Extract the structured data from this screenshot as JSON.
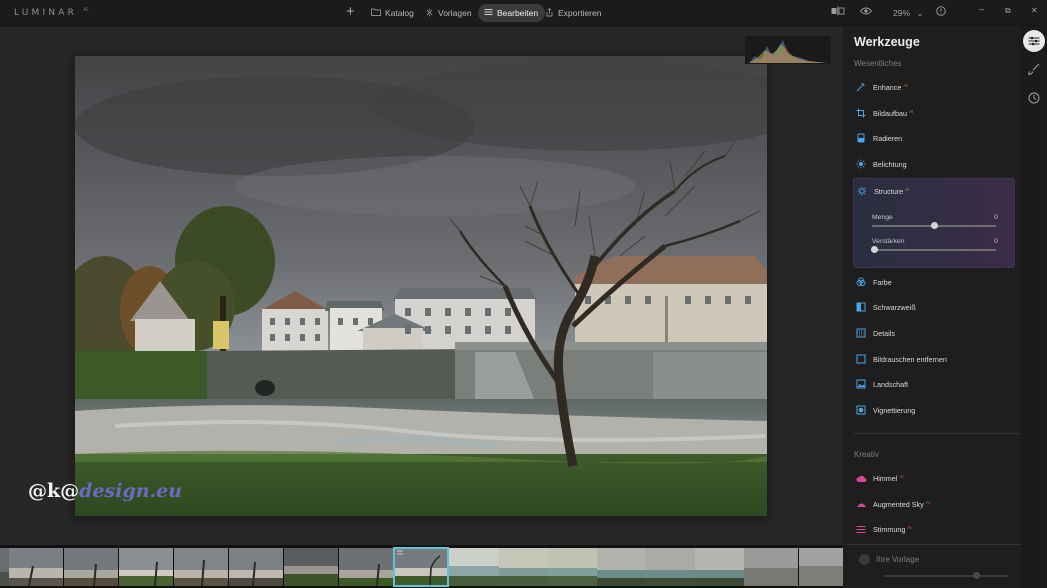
{
  "app": {
    "logo": "LUMINAR",
    "logo_sup": "AI"
  },
  "nav": {
    "add": "+",
    "items": [
      {
        "label": "Katalog",
        "icon": "folder-icon"
      },
      {
        "label": "Vorlagen",
        "icon": "sparkle-icon"
      },
      {
        "label": "Bearbeiten",
        "icon": "sliders-icon",
        "active": true
      },
      {
        "label": "Exportieren",
        "icon": "share-icon"
      }
    ]
  },
  "topright": {
    "zoom": "29%",
    "zoom_caret": "⌄",
    "minimize": "–",
    "restore": "⧉",
    "close": "✕"
  },
  "watermark": {
    "prefix": "@k@",
    "suffix": "design.eu"
  },
  "panel": {
    "title": "Werkzeuge",
    "essentials_label": "Wesentliches",
    "creative_label": "Kreativ",
    "ai_badge": "AI",
    "essentials": [
      {
        "label": "Enhance",
        "ai": true,
        "icon": "enhance-icon"
      },
      {
        "label": "Bildaufbau",
        "ai": true,
        "icon": "crop-icon"
      },
      {
        "label": "Radieren",
        "ai": false,
        "icon": "eraser-icon"
      },
      {
        "label": "Belichtung",
        "ai": false,
        "icon": "sun-icon"
      },
      {
        "label": "Structure",
        "ai": true,
        "icon": "structure-icon",
        "expanded": true
      },
      {
        "label": "Farbe",
        "ai": false,
        "icon": "color-icon"
      },
      {
        "label": "Schwarzweiß",
        "ai": false,
        "icon": "bw-icon"
      },
      {
        "label": "Details",
        "ai": false,
        "icon": "details-icon"
      },
      {
        "label": "Bildrauschen entfernen",
        "ai": false,
        "icon": "denoise-icon"
      },
      {
        "label": "Landschaft",
        "ai": false,
        "icon": "landscape-icon"
      },
      {
        "label": "Vignettierung",
        "ai": false,
        "icon": "vignette-icon"
      }
    ],
    "structure_sliders": [
      {
        "label": "Menge",
        "value": "0",
        "fraction": 0.5
      },
      {
        "label": "Verstärken",
        "value": "0",
        "fraction": 0.0
      }
    ],
    "creative": [
      {
        "label": "Himmel",
        "ai": true,
        "icon": "cloud-icon"
      },
      {
        "label": "Augmented Sky",
        "ai": true,
        "icon": "sky-icon"
      },
      {
        "label": "Stimmung",
        "ai": true,
        "icon": "mood-icon"
      }
    ],
    "preset_label": "Ihre Vorlage"
  },
  "colors": {
    "accent_ai": "#d27b30",
    "accent_pink": "#d7479a",
    "icon_blue": "#4aa6e8",
    "selection": "#5fc3d7"
  }
}
